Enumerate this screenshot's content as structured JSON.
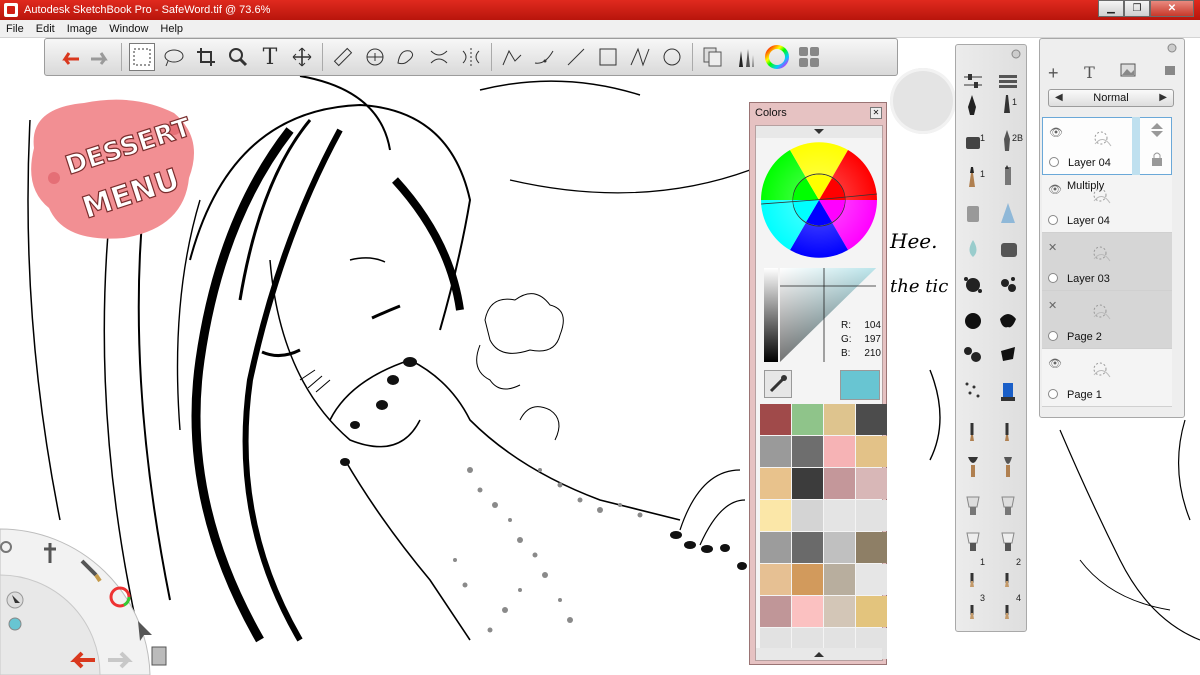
{
  "titlebar": {
    "app_title": "Autodesk SketchBook Pro - SafeWord.tif @ 73.6%",
    "minimize": "▁",
    "maximize": "❐",
    "close": "✕"
  },
  "menu": [
    "File",
    "Edit",
    "Image",
    "Window",
    "Help"
  ],
  "toolbar": {
    "icons": [
      "undo-icon",
      "redo-icon",
      "rect-select-icon",
      "lasso-icon",
      "crop-icon",
      "zoom-icon",
      "text-icon",
      "move-icon",
      "ruler-icon",
      "ellipse-guide-icon",
      "french-curve-icon",
      "symmetry-x-icon",
      "symmetry-y-icon",
      "line-stroke-icon",
      "curve-stroke-icon",
      "straight-line-icon",
      "rectangle-icon",
      "polyline-icon",
      "circle-icon",
      "copy-paste-icon",
      "brushes-icon",
      "color-wheel-icon",
      "palette-icon"
    ]
  },
  "logo": {
    "line1": "DESSERT",
    "line2": "MENU"
  },
  "colors_panel": {
    "title": "Colors",
    "r_label": "R:",
    "r_value": "104",
    "g_label": "G:",
    "g_value": "197",
    "b_label": "B:",
    "b_value": "210",
    "current_color": "#68c5d2",
    "swatches": [
      "#a04a4a",
      "#8fc48a",
      "#dec48e",
      "#4c4c4c",
      "#9a9a9a",
      "#6e6e6e",
      "#f6b3b5",
      "#e3c288",
      "#e8c28c",
      "#3c3c3c",
      "#c4979a",
      "#d8b7b7",
      "#fbe7a8",
      "#d4d4d4",
      "#e4e4e4",
      "#e2e2e2",
      "#9c9c9c",
      "#6a6a6a",
      "#c0c0c0",
      "#8e7f66",
      "#e6c093",
      "#d29a5c",
      "#b8ae9e",
      "#e6e6e6",
      "#c09698",
      "#fbc1c1",
      "#d3c6b7",
      "#e3c47d",
      "#e2e2e2",
      "#e2e2e2",
      "#e2e2e2",
      "#e2e2e2"
    ]
  },
  "brush_palette": {
    "numbers": [
      "1",
      "1",
      "2B",
      "1",
      "1",
      "2",
      "3",
      "4"
    ]
  },
  "layers": {
    "blend_mode": "Normal",
    "items": [
      {
        "name": "Layer 04",
        "blend": "",
        "visible": true
      },
      {
        "name": "Layer 04",
        "blend": "Multiply",
        "visible": true
      },
      {
        "name": "Layer 03",
        "blend": "",
        "visible": false
      },
      {
        "name": "Page 2",
        "blend": "",
        "visible": false
      },
      {
        "name": "Page 1",
        "blend": "",
        "visible": true
      }
    ]
  },
  "canvas_text": {
    "hee": "Hee.",
    "tic": "the tic"
  }
}
